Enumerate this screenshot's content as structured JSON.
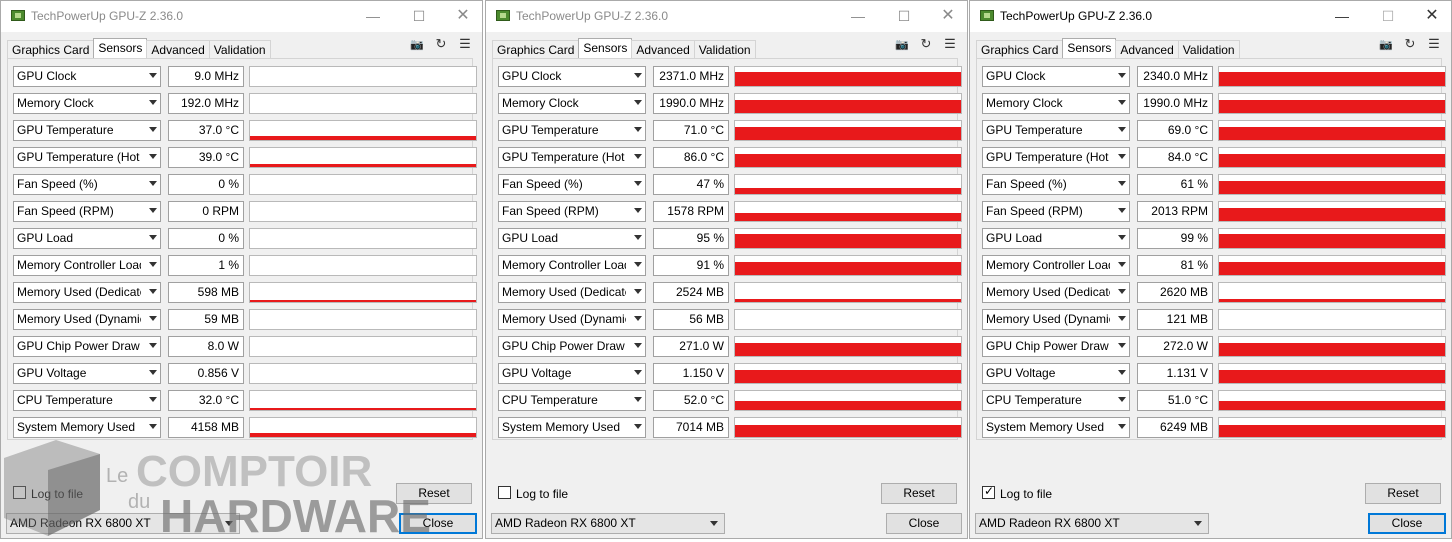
{
  "title": "TechPowerUp GPU-Z 2.36.0",
  "tabs": [
    "Graphics Card",
    "Sensors",
    "Advanced",
    "Validation"
  ],
  "active_tab": "Sensors",
  "log_label": "Log to file",
  "reset_label": "Reset",
  "close_label": "Close",
  "gpu_name": "AMD Radeon RX 6800 XT",
  "graph_color": "#e8191b",
  "sensor_names": [
    "GPU Clock",
    "Memory Clock",
    "GPU Temperature",
    "GPU Temperature (Hot Spot)",
    "Fan Speed (%)",
    "Fan Speed (RPM)",
    "GPU Load",
    "Memory Controller Load",
    "Memory Used (Dedicated)",
    "Memory Used (Dynamic)",
    "GPU Chip Power Draw",
    "GPU Voltage",
    "CPU Temperature",
    "System Memory Used"
  ],
  "watermark": {
    "le": "Le",
    "du": "du",
    "comptoir": "COMPTOIR",
    "hardware": "HARDWARE"
  },
  "windows": [
    {
      "active": false,
      "log_checked": false,
      "values": [
        "9.0 MHz",
        "192.0 MHz",
        "37.0 °C",
        "39.0 °C",
        "0 %",
        "0 RPM",
        "0 %",
        "1 %",
        "598 MB",
        "59 MB",
        "8.0 W",
        "0.856 V",
        "32.0 °C",
        "4158 MB"
      ],
      "levels": [
        0,
        0,
        0.25,
        0.2,
        0,
        0,
        0,
        0,
        0.05,
        0,
        0,
        0,
        0.12,
        0.25
      ]
    },
    {
      "active": false,
      "log_checked": false,
      "values": [
        "2371.0 MHz",
        "1990.0 MHz",
        "71.0 °C",
        "86.0 °C",
        "47 %",
        "1578 RPM",
        "95 %",
        "91 %",
        "2524 MB",
        "56 MB",
        "271.0 W",
        "1.150 V",
        "52.0 °C",
        "7014 MB"
      ],
      "levels": [
        0.8,
        0.75,
        0.75,
        0.75,
        0.35,
        0.45,
        0.85,
        0.75,
        0.15,
        0,
        0.75,
        0.75,
        0.5,
        0.7
      ]
    },
    {
      "active": true,
      "log_checked": true,
      "values": [
        "2340.0 MHz",
        "1990.0 MHz",
        "69.0 °C",
        "84.0 °C",
        "61 %",
        "2013 RPM",
        "99 %",
        "81 %",
        "2620 MB",
        "121 MB",
        "272.0 W",
        "1.131 V",
        "51.0 °C",
        "6249 MB"
      ],
      "levels": [
        0.8,
        0.75,
        0.75,
        0.75,
        0.75,
        0.75,
        0.85,
        0.75,
        0.15,
        0,
        0.75,
        0.75,
        0.5,
        0.7
      ]
    }
  ]
}
